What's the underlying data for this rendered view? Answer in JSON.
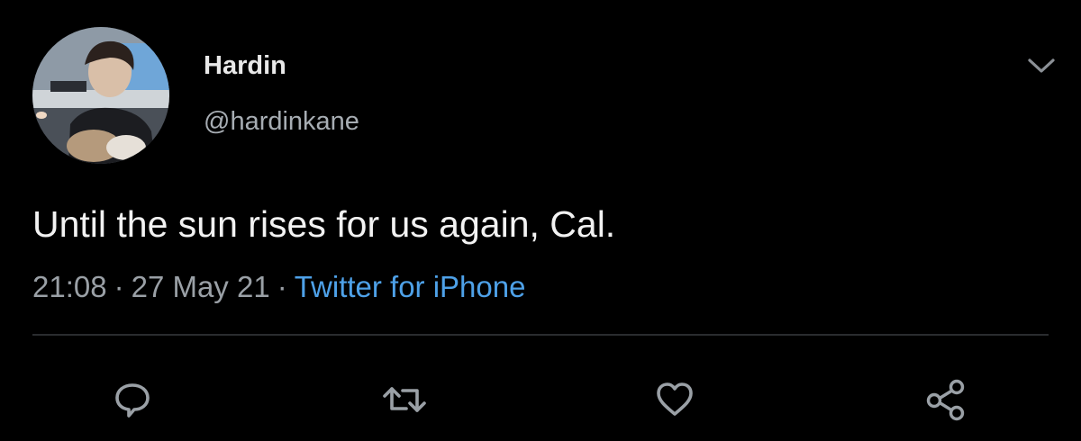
{
  "tweet": {
    "author": {
      "display_name": "Hardin",
      "handle": "@hardinkane",
      "avatar_icon": "profile-photo"
    },
    "text": "Until the sun rises for us again, Cal.",
    "time": "21:08",
    "date": "27 May 21",
    "separator": "·",
    "source": "Twitter for iPhone"
  },
  "actions": [
    {
      "name": "reply",
      "icon": "speech-bubble-icon"
    },
    {
      "name": "retweet",
      "icon": "retweet-arrows-icon"
    },
    {
      "name": "like",
      "icon": "heart-icon"
    },
    {
      "name": "share",
      "icon": "share-nodes-icon"
    }
  ],
  "colors": {
    "background": "#000000",
    "text": "#f2f2f2",
    "secondary": "#9aa0a6",
    "link": "#4ea1e8",
    "divider": "#2a2c2f"
  }
}
